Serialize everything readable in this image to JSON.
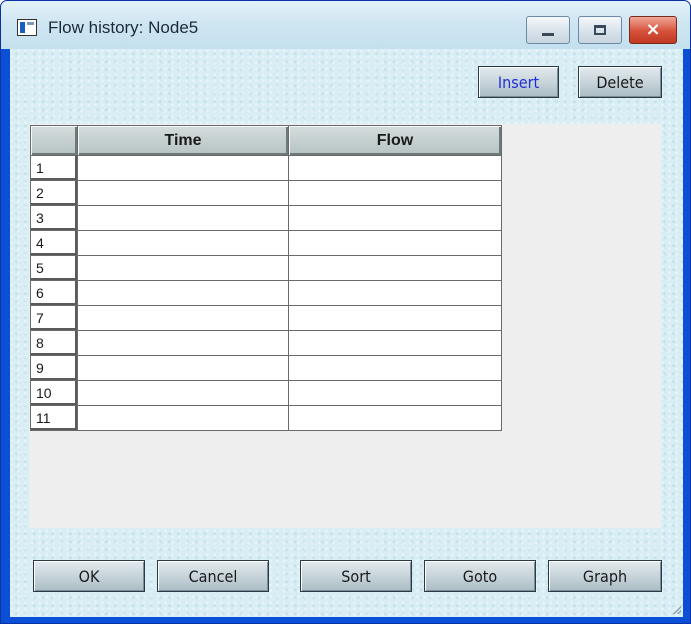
{
  "window": {
    "title": "Flow history: Node5",
    "controls": {
      "minimize_icon": "minimize-icon",
      "maximize_icon": "maximize-icon",
      "close_icon": "close-icon",
      "close_glyph": "×"
    }
  },
  "toolbar": {
    "insert_label": "Insert",
    "delete_label": "Delete"
  },
  "table": {
    "columns": [
      "",
      "Time",
      "Flow"
    ],
    "rows": [
      {
        "num": "1",
        "time": "",
        "flow": ""
      },
      {
        "num": "2",
        "time": "",
        "flow": ""
      },
      {
        "num": "3",
        "time": "",
        "flow": ""
      },
      {
        "num": "4",
        "time": "",
        "flow": ""
      },
      {
        "num": "5",
        "time": "",
        "flow": ""
      },
      {
        "num": "6",
        "time": "",
        "flow": ""
      },
      {
        "num": "7",
        "time": "",
        "flow": ""
      },
      {
        "num": "8",
        "time": "",
        "flow": ""
      },
      {
        "num": "9",
        "time": "",
        "flow": ""
      },
      {
        "num": "10",
        "time": "",
        "flow": ""
      },
      {
        "num": "11",
        "time": "",
        "flow": ""
      }
    ]
  },
  "footer": {
    "ok_label": "OK",
    "cancel_label": "Cancel",
    "sort_label": "Sort",
    "goto_label": "Goto",
    "graph_label": "Graph"
  },
  "colors": {
    "insert_text": "#1f2fd8",
    "client_background": "#d8eef4",
    "close_button": "#d6503a"
  }
}
